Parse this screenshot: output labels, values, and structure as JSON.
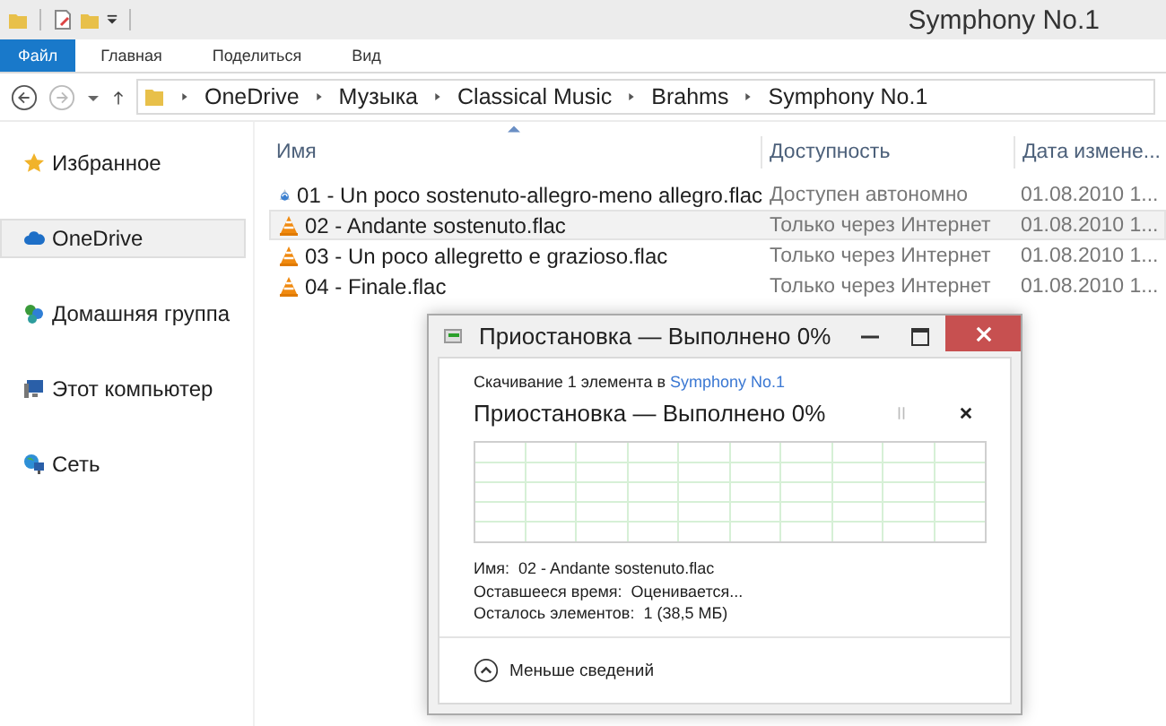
{
  "window": {
    "title": "Symphony No.1"
  },
  "ribbon": {
    "tabs": [
      {
        "label": "Файл",
        "selected": true
      },
      {
        "label": "Главная",
        "selected": false
      },
      {
        "label": "Поделиться",
        "selected": false
      },
      {
        "label": "Вид",
        "selected": false
      }
    ]
  },
  "breadcrumb": [
    "OneDrive",
    "Музыка",
    "Classical Music",
    "Brahms",
    "Symphony No.1"
  ],
  "sidebar": {
    "items": [
      {
        "label": "Избранное",
        "kind": "star",
        "selected": false
      },
      {
        "label": "OneDrive",
        "kind": "cloud",
        "selected": true
      },
      {
        "label": "Домашняя группа",
        "kind": "homegroup",
        "selected": false
      },
      {
        "label": "Этот компьютер",
        "kind": "computer",
        "selected": false
      },
      {
        "label": "Сеть",
        "kind": "network",
        "selected": false
      }
    ]
  },
  "file_list": {
    "columns": [
      "Имя",
      "Доступность",
      "Дата измене..."
    ],
    "rows": [
      {
        "name": "01 - Un poco sostenuto-allegro-meno allegro.flac",
        "availability": "Доступен автономно",
        "date": "01.08.2010 1...",
        "kind": "syncing",
        "selected": false
      },
      {
        "name": "02 - Andante sostenuto.flac",
        "availability": "Только через Интернет",
        "date": "01.08.2010 1...",
        "kind": "cone",
        "selected": true
      },
      {
        "name": "03 - Un poco allegretto e grazioso.flac",
        "availability": "Только через Интернет",
        "date": "01.08.2010 1...",
        "kind": "cone",
        "selected": false
      },
      {
        "name": "04 - Finale.flac",
        "availability": "Только через Интернет",
        "date": "01.08.2010 1...",
        "kind": "cone",
        "selected": false
      }
    ]
  },
  "dialog": {
    "title": "Приостановка — Выполнено 0%",
    "caption": "Скачивание 1 элемента в ",
    "caption_link": "Symphony No.1",
    "status": "Приостановка — Выполнено 0%",
    "details": [
      {
        "label": "Имя:",
        "value": "02 - Andante sostenuto.flac"
      },
      {
        "label": "Оставшееся время:",
        "value": "Оценивается..."
      },
      {
        "label": "Осталось элементов:",
        "value": "1 (38,5 МБ)"
      }
    ],
    "toggle": "Меньше сведений"
  }
}
